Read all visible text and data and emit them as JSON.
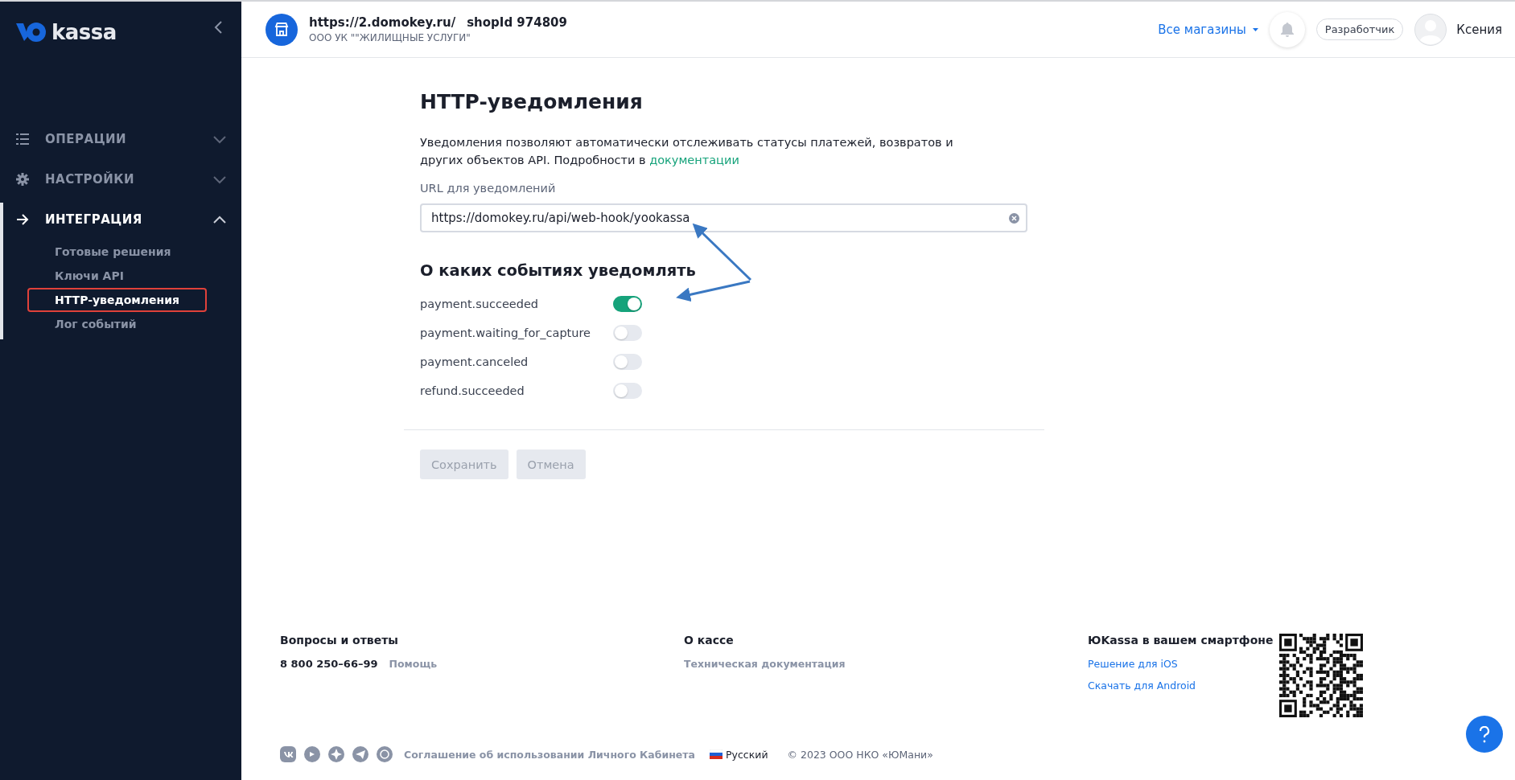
{
  "sidebar": {
    "logo_text": "kassa",
    "sections": [
      {
        "kind": "list",
        "label": "ОПЕРАЦИИ",
        "expanded": false
      },
      {
        "kind": "gear",
        "label": "НАСТРОЙКИ",
        "expanded": false
      },
      {
        "kind": "arrow",
        "label": "ИНТЕГРАЦИЯ",
        "expanded": true,
        "children": [
          {
            "label": "Готовые решения",
            "selected": false,
            "highlighted": false
          },
          {
            "label": "Ключи API",
            "selected": false,
            "highlighted": false
          },
          {
            "label": "HTTP-уведомления",
            "selected": true,
            "highlighted": true
          },
          {
            "label": "Лог событий",
            "selected": false,
            "highlighted": false
          }
        ]
      }
    ]
  },
  "header": {
    "store_url": "https://2.domokey.ru/",
    "shop_id": "shopId 974809",
    "org_name": "ООО УК \"\"ЖИЛИЩНЫЕ УСЛУГИ\"",
    "shops_menu": "Все магазины",
    "developer_button": "Разработчик",
    "user_name": "Ксения"
  },
  "content": {
    "title": "HTTP-уведомления",
    "description": "Уведомления позволяют автоматически отслеживать статусы платежей, возвратов и других объектов API. Подробности в ",
    "description_link": "документации",
    "url_label": "URL для уведомлений",
    "url_value": "https://domokey.ru/api/web-hook/yookassa",
    "events_title": "О каких событиях уведомлять",
    "events": [
      {
        "name": "payment.succeeded",
        "on": true
      },
      {
        "name": "payment.waiting_for_capture",
        "on": false
      },
      {
        "name": "payment.canceled",
        "on": false
      },
      {
        "name": "refund.succeeded",
        "on": false
      }
    ],
    "buttons": [
      {
        "label": "Сохранить",
        "disabled": true
      },
      {
        "label": "Отмена",
        "disabled": true
      }
    ]
  },
  "footer": {
    "columns": [
      {
        "title": "Вопросы и ответы",
        "phone": "8 800 250–66–99",
        "links": [
          "Помощь"
        ]
      },
      {
        "title": "О кассе",
        "links": [
          "Техническая документация"
        ]
      },
      {
        "title": "ЮKassa в вашем смартфоне",
        "links": [
          "Решение для iOS",
          "Скачать для Android"
        ]
      }
    ],
    "agreement": "Соглашение об использовании Личного Кабинета",
    "language": "Русский",
    "copyright": "© 2023 ООО НКО «ЮМани»"
  }
}
